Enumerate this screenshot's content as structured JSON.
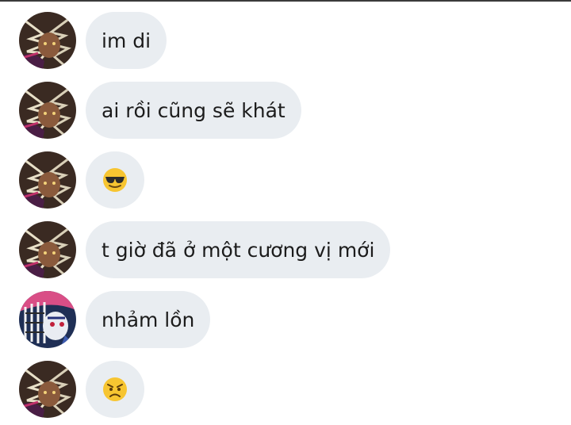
{
  "messages": [
    {
      "sender": "friend",
      "text": "im di"
    },
    {
      "sender": "friend",
      "text": "ai rồi cũng sẽ khát"
    },
    {
      "sender": "friend",
      "emoji": "sunglasses-face-emoji"
    },
    {
      "sender": "friend",
      "text": "t giờ đã ở một cương vị mới"
    },
    {
      "sender": "other",
      "text": "nhảm lồn"
    },
    {
      "sender": "friend",
      "emoji": "angry-face-emoji"
    }
  ],
  "colors": {
    "bubble": "#e9edf1",
    "text": "#1c1c1c",
    "background": "#ffffff"
  }
}
